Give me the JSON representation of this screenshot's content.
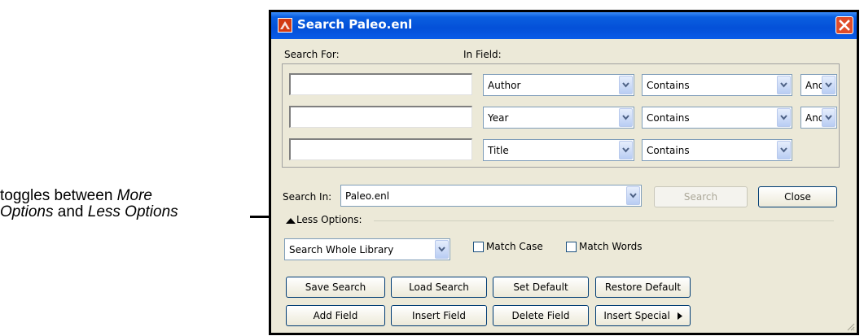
{
  "annotation": {
    "line1_prefix": "toggles between ",
    "line1_italic": "More",
    "line2_italic_a": "Options",
    "line2_mid": " and ",
    "line2_italic_b": "Less Options"
  },
  "window": {
    "title": "Search Paleo.enl",
    "icons": {
      "app": "endnote-app-icon",
      "close": "close-icon"
    }
  },
  "labels": {
    "search_for": "Search For:",
    "in_field": "In Field:",
    "search_in": "Search In:",
    "less_options": "Less Options:",
    "match_case": "Match Case",
    "match_words": "Match Words"
  },
  "criteria": [
    {
      "value": "",
      "field": "Author",
      "operator": "Contains",
      "bool": "And"
    },
    {
      "value": "",
      "field": "Year",
      "operator": "Contains",
      "bool": "And"
    },
    {
      "value": "",
      "field": "Title",
      "operator": "Contains",
      "bool": ""
    }
  ],
  "search_in": {
    "value": "Paleo.enl"
  },
  "scope": {
    "value": "Search Whole Library"
  },
  "buttons": {
    "search": "Search",
    "close": "Close",
    "save_search": "Save Search",
    "load_search": "Load Search",
    "set_default": "Set Default",
    "restore_default": "Restore Default",
    "add_field": "Add Field",
    "insert_field": "Insert Field",
    "delete_field": "Delete Field",
    "insert_special": "Insert Special"
  },
  "colors": {
    "title_bar": "#0450d8",
    "window_bg": "#ece9d8",
    "close_button": "#e04d2a",
    "disabled_text": "#aca899"
  }
}
